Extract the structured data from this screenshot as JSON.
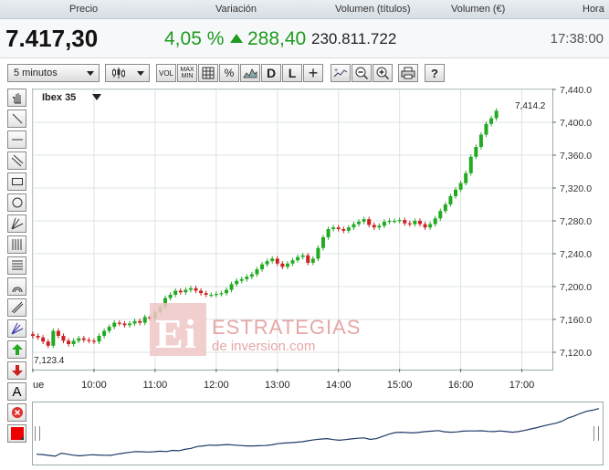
{
  "header": {
    "col_price": "Precio",
    "col_change": "Variación",
    "col_volume_titles": "Volumen (títulos)",
    "col_volume_eur": "Volumen (€)",
    "col_time": "Hora"
  },
  "quote": {
    "price": "7.417,30",
    "change_pct": "4,05 %",
    "change_abs": "288,40",
    "volume": "230.811.722",
    "time": "17:38:00",
    "up_color": "#1f9a1f"
  },
  "toolbar": {
    "interval": "5 minutos",
    "vol": "VOL",
    "max": "MAX",
    "min": "MIN",
    "pct": "%",
    "d": "D",
    "l": "L",
    "plus": "+",
    "help": "?"
  },
  "sidebar": {
    "text_tool": "A"
  },
  "watermark": {
    "line1": "ESTRATEGIAS",
    "line2": "de inversion.com"
  },
  "chart_data": {
    "type": "candlestick",
    "title": "Ibex 35",
    "interval": "5 minutos",
    "ylim": [
      7100,
      7440
    ],
    "y_ticks": [
      "7,440.0",
      "7,400.0",
      "7,360.0",
      "7,320.0",
      "7,280.0",
      "7,240.0",
      "7,200.0",
      "7,160.0",
      "7,120.0"
    ],
    "y_tick_values": [
      7440,
      7400,
      7360,
      7320,
      7280,
      7240,
      7200,
      7160,
      7120
    ],
    "x_ticks": [
      "ue",
      "10:00",
      "11:00",
      "12:00",
      "13:00",
      "14:00",
      "15:00",
      "16:00",
      "17:00"
    ],
    "x_tick_times": [
      9.0,
      10.0,
      11.0,
      12.0,
      13.0,
      14.0,
      15.0,
      16.0,
      17.0
    ],
    "x_range": [
      9.0,
      17.5
    ],
    "min_label": "7,123.4",
    "max_label": "7,414.2",
    "up_color": "#22aa22",
    "down_color": "#cc2222",
    "closes": [
      7140,
      7138,
      7133,
      7128,
      7146,
      7140,
      7134,
      7130,
      7134,
      7137,
      7135,
      7134,
      7133,
      7140,
      7146,
      7151,
      7156,
      7155,
      7153,
      7155,
      7158,
      7156,
      7163,
      7161,
      7169,
      7175,
      7186,
      7190,
      7195,
      7193,
      7196,
      7198,
      7195,
      7192,
      7190,
      7190,
      7191,
      7192,
      7196,
      7203,
      7207,
      7209,
      7212,
      7215,
      7221,
      7227,
      7231,
      7234,
      7228,
      7224,
      7228,
      7232,
      7236,
      7238,
      7229,
      7234,
      7247,
      7260,
      7270,
      7272,
      7270,
      7268,
      7272,
      7276,
      7279,
      7282,
      7275,
      7272,
      7274,
      7279,
      7280,
      7280,
      7281,
      7277,
      7276,
      7280,
      7276,
      7272,
      7276,
      7283,
      7292,
      7300,
      7310,
      7318,
      7326,
      7338,
      7358,
      7370,
      7385,
      7398,
      7405,
      7414
    ]
  }
}
